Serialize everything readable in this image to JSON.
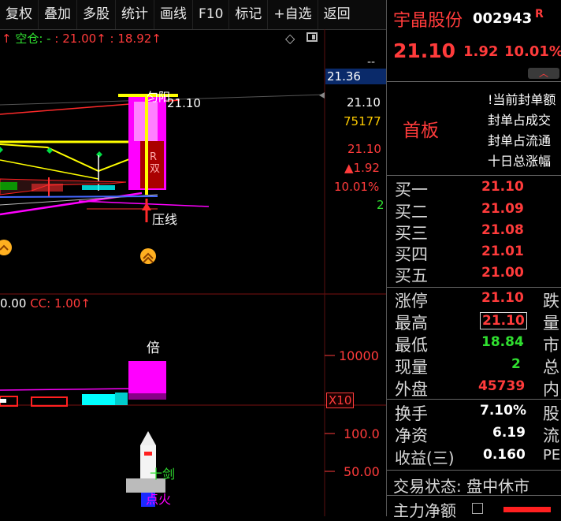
{
  "toolbar": {
    "items": [
      "复权",
      "叠加",
      "多股",
      "统计",
      "画线",
      "F10",
      "标记",
      "+自选",
      "返回"
    ]
  },
  "main_chart": {
    "header_prefix": "↑",
    "header_text": "空仓: -",
    "value1": ": 21.00",
    "value2": ": 18.92",
    "arrow": "↑",
    "price_scale": [
      "--",
      "21.36"
    ],
    "labels": {
      "price_label": "21.10",
      "annotation_top": "匀阳",
      "annotation_mid": "R\n双",
      "annotation_line": "压线",
      "annotation_fire": "↑"
    },
    "right_values": [
      "21.10",
      "75177",
      "21.10",
      "▲1.92",
      "10.01%",
      "2"
    ]
  },
  "volume_panel": {
    "header_value": "0.00",
    "cc_label": "CC: 1.00",
    "arrow": "↑",
    "bar_label": "倍",
    "scale": "10000",
    "multiplier": "X10"
  },
  "indicator_panel": {
    "scale_top": "100.0",
    "scale_mid": "50.00",
    "label_sword": "十剑",
    "label_fire": "点火"
  },
  "quote": {
    "name": "宇晶股份",
    "code": "002943",
    "badge": "R",
    "price": "21.10",
    "change": "1.92",
    "change_pct": "10.01%",
    "board": "首板",
    "info_lines": [
      "!当前封单额",
      "封单占成交",
      "封单占流通",
      "十日总涨幅"
    ],
    "bids": [
      {
        "label": "买一",
        "price": "21.10"
      },
      {
        "label": "买二",
        "price": "21.09"
      },
      {
        "label": "买三",
        "price": "21.08"
      },
      {
        "label": "买四",
        "price": "21.01"
      },
      {
        "label": "买五",
        "price": "21.00"
      }
    ],
    "stats": [
      {
        "label": "涨停",
        "value": "21.10",
        "color": "#ff3b3b",
        "extra": "跌"
      },
      {
        "label": "最高",
        "value": "21.10",
        "color": "#ff3b3b",
        "extra": "量"
      },
      {
        "label": "最低",
        "value": "18.84",
        "color": "#30e030",
        "extra": "市"
      },
      {
        "label": "现量",
        "value": "2",
        "color": "#30e030",
        "extra": "总"
      },
      {
        "label": "外盘",
        "value": "45739",
        "color": "#ff3b3b",
        "extra": "内"
      }
    ],
    "fin": [
      {
        "label": "换手",
        "value": "7.10%",
        "extra": "股"
      },
      {
        "label": "净资",
        "value": "6.19",
        "extra": "流"
      },
      {
        "label": "收益(三)",
        "value": "0.160",
        "extra": "PE"
      }
    ],
    "trade_status": "交易状态: 盘中休市",
    "main_flow": "主力净额"
  },
  "colors": {
    "accent_red": "#ff3b3b",
    "accent_green": "#30e030",
    "accent_yellow": "#ffff00",
    "accent_magenta": "#ff00ff",
    "accent_cyan": "#00ffff"
  }
}
